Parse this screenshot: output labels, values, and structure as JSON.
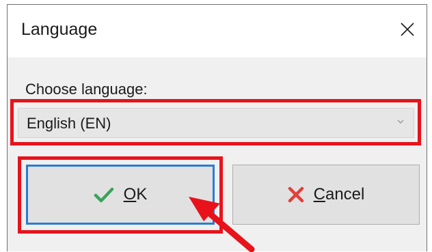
{
  "window": {
    "title": "Language",
    "close_icon": "close-icon"
  },
  "form": {
    "prompt": "Choose language:",
    "language_select": {
      "selected": "English (EN)",
      "chevron_icon": "chevron-down-icon"
    }
  },
  "buttons": {
    "ok": {
      "mnemonic": "O",
      "rest": "K",
      "icon": "checkmark-icon"
    },
    "cancel": {
      "mnemonic": "C",
      "rest": "ancel",
      "icon": "cross-icon"
    }
  },
  "annotation": {
    "highlight_color": "#e8121b"
  },
  "colors": {
    "ok_focus_border": "#2a7bd4",
    "check_green": "#3aa35a",
    "cancel_red": "#e0403a"
  }
}
